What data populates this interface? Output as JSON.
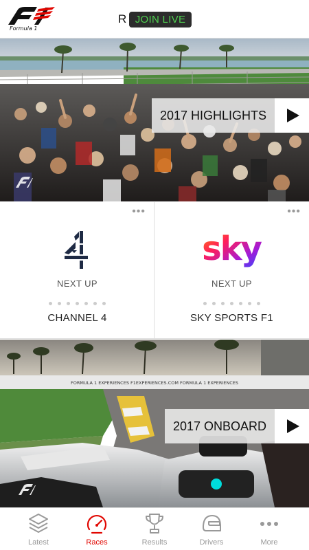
{
  "header": {
    "brand_logo_text": "Formula 1",
    "r_letter": "R",
    "join_live_label": "JOIN LIVE"
  },
  "hero_top": {
    "label": "2017 HIGHLIGHTS"
  },
  "broadcasters": [
    {
      "logo_text": "4",
      "next_up": "NEXT UP",
      "name": "CHANNEL 4"
    },
    {
      "logo_text": "sky",
      "next_up": "NEXT UP",
      "name": "SKY SPORTS F1"
    }
  ],
  "hero_bottom": {
    "label": "2017 ONBOARD",
    "hoarding_text": "FORMULA 1 EXPERIENCES   F1EXPERIENCES.COM   FORMULA 1 EXPERIENCES"
  },
  "tabs": [
    {
      "label": "Latest",
      "icon": "layers-icon",
      "active": false
    },
    {
      "label": "Races",
      "icon": "speedometer-icon",
      "active": true
    },
    {
      "label": "Results",
      "icon": "trophy-icon",
      "active": false
    },
    {
      "label": "Drivers",
      "icon": "helmet-icon",
      "active": false
    },
    {
      "label": "More",
      "icon": "more-dots-icon",
      "active": false
    }
  ],
  "colors": {
    "brand_red": "#e10600",
    "join_live_green": "#4fd04f",
    "tab_inactive": "#999999"
  }
}
